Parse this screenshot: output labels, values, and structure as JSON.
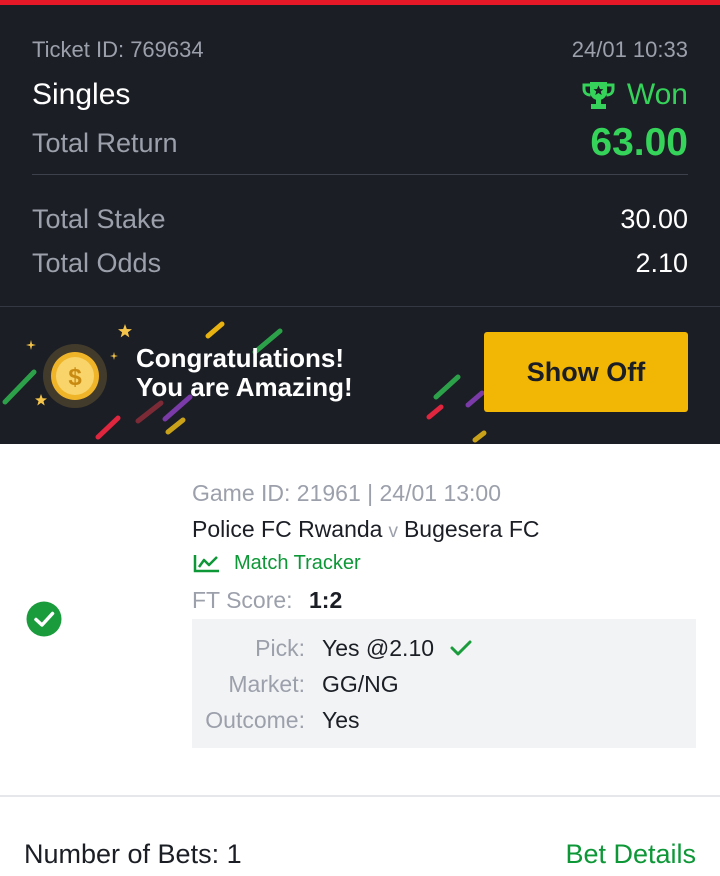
{
  "ticket": {
    "id_label": "Ticket ID: 769634",
    "datetime": "24/01 10:33",
    "type": "Singles",
    "status": "Won",
    "total_return_label": "Total Return",
    "total_return": "63.00",
    "total_stake_label": "Total Stake",
    "total_stake": "30.00",
    "total_odds_label": "Total Odds",
    "total_odds": "2.10"
  },
  "banner": {
    "line1": "Congratulations!",
    "line2": "You are Amazing!",
    "button": "Show Off"
  },
  "game": {
    "id_line": "Game ID: 21961 | 24/01 13:00",
    "home": "Police FC Rwanda",
    "vs": "v",
    "away": "Bugesera FC",
    "tracker_label": "Match Tracker",
    "ft_label": "FT Score:",
    "ft_value": "1:2",
    "pick_label": "Pick:",
    "pick_value": "Yes @2.10",
    "market_label": "Market:",
    "market_value": "GG/NG",
    "outcome_label": "Outcome:",
    "outcome_value": "Yes"
  },
  "footer": {
    "bets_count": "Number of Bets: 1",
    "details_link": "Bet Details"
  },
  "colors": {
    "accent_red": "#e41827",
    "win_green": "#35d35a",
    "link_green": "#0d9737",
    "button_yellow": "#f2b705",
    "dark_bg": "#1b1e25"
  },
  "icons": [
    "trophy-icon",
    "coin-icon",
    "star-icon",
    "chart-line-icon",
    "check-circle-icon",
    "checkmark-icon"
  ]
}
